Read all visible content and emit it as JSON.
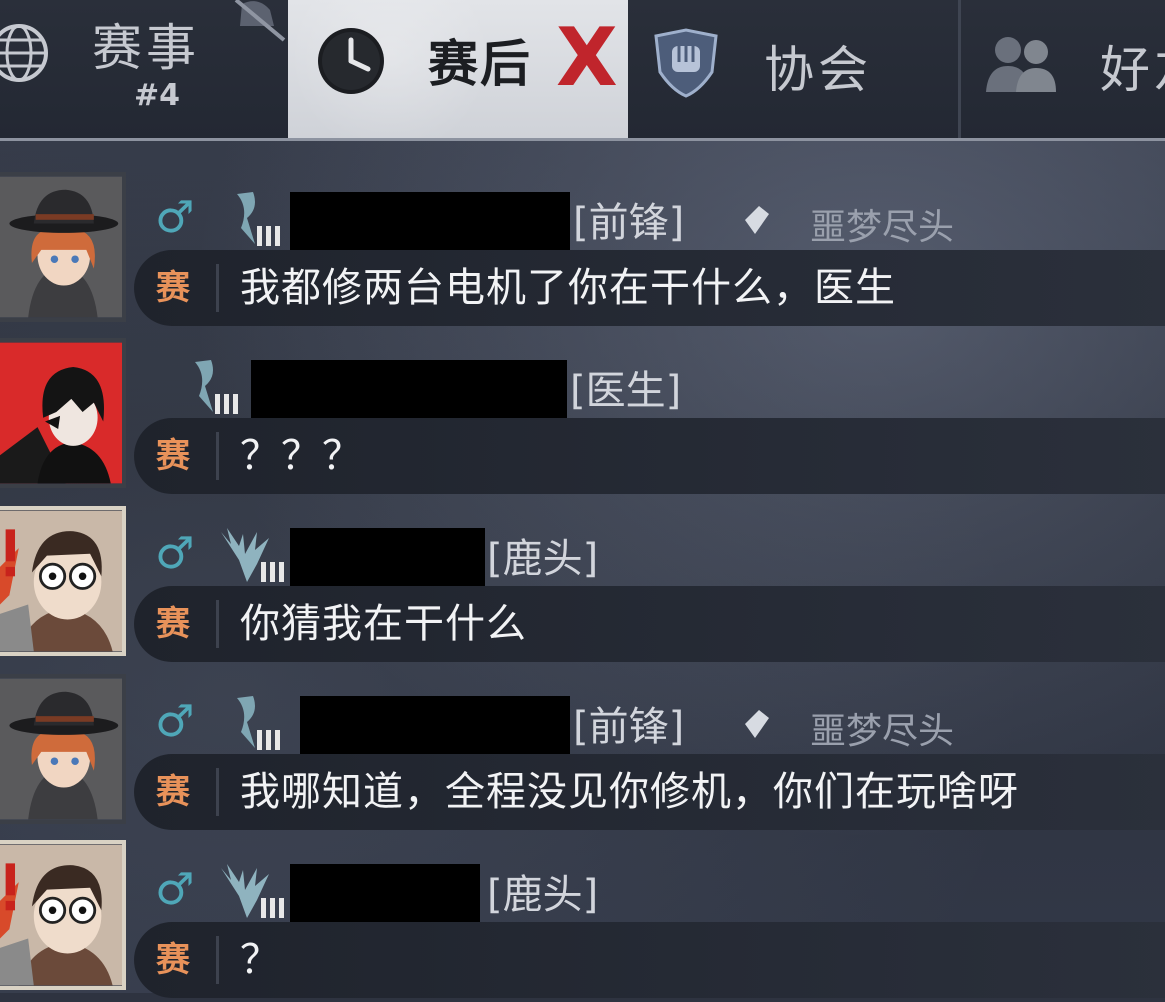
{
  "tabs": {
    "events": {
      "label": "赛事",
      "sub": "#4"
    },
    "after": {
      "label": "赛后",
      "mark": "X"
    },
    "guild": {
      "label": "协会"
    },
    "friends": {
      "label": "好友"
    }
  },
  "colors": {
    "gender": "#4fa7b8",
    "channel": "#e8925a",
    "highlight_x": "#c0252c",
    "text": "#f2f3f5"
  },
  "messages": [
    {
      "gender": "♂",
      "role": "[前锋]",
      "tier": "噩梦尽头",
      "channel": "赛",
      "text": "我都修两台电机了你在干什么，医生",
      "avatar": "fedora-character"
    },
    {
      "gender": "",
      "role": "[医生]",
      "tier": "",
      "channel": "赛",
      "text": "？？？",
      "avatar": "dark-hair-character"
    },
    {
      "gender": "♂",
      "role": "[鹿头]",
      "tier": "",
      "channel": "赛",
      "text": "你猜我在干什么",
      "avatar": "startled-character"
    },
    {
      "gender": "♂",
      "role": "[前锋]",
      "tier": "噩梦尽头",
      "channel": "赛",
      "text": "我哪知道，全程没见你修机，你们在玩啥呀",
      "avatar": "fedora-character"
    },
    {
      "gender": "♂",
      "role": "[鹿头]",
      "tier": "",
      "channel": "赛",
      "text": "？",
      "avatar": "startled-character"
    }
  ]
}
